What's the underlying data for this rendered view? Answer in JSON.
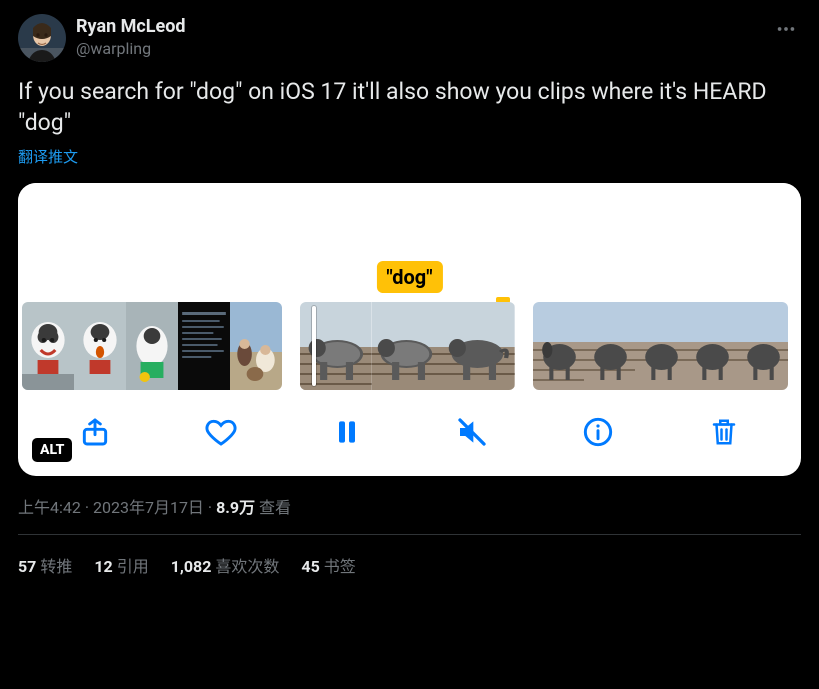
{
  "author": {
    "display_name": "Ryan McLeod",
    "handle": "@warpling"
  },
  "tweet": {
    "text": "If you search for \"dog\" on iOS 17 it'll also show you clips where it's HEARD \"dog\"",
    "translate_label": "翻译推文"
  },
  "media": {
    "search_term_label": "\"dog\"",
    "alt_badge": "ALT"
  },
  "meta": {
    "time": "上午4:42",
    "dot1": " · ",
    "date": "2023年7月17日",
    "dot2": " · ",
    "views_num": "8.9万",
    "views_label": " 查看"
  },
  "stats": {
    "retweets_num": "57",
    "retweets_label": "转推",
    "quotes_num": "12",
    "quotes_label": "引用",
    "likes_num": "1,082",
    "likes_label": "喜欢次数",
    "bookmarks_num": "45",
    "bookmarks_label": "书签"
  }
}
